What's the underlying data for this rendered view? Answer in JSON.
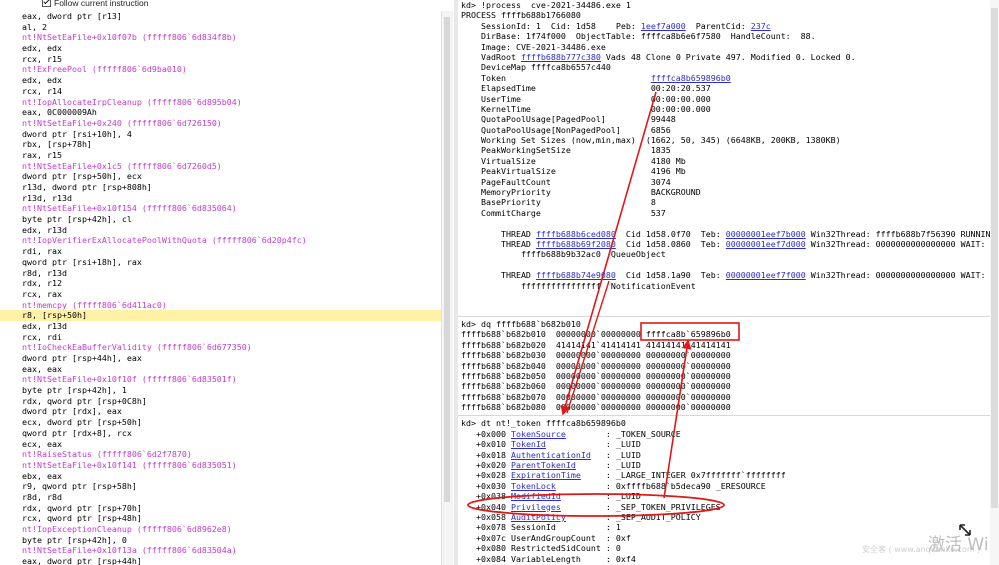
{
  "left_pane": {
    "follow_label": "Follow current instruction",
    "lines": [
      {
        "t": "eax, dword ptr [r13]",
        "c": false
      },
      {
        "t": "al, 2",
        "c": false
      },
      {
        "t": "nt!NtSetEaFile+0x10f07b (fffff806`6d834f8b)",
        "c": true
      },
      {
        "t": "edx, edx",
        "c": false
      },
      {
        "t": "rcx, r15",
        "c": false
      },
      {
        "t": "nt!ExFreePool (fffff806`6d9ba010)",
        "c": true
      },
      {
        "t": "edx, edx",
        "c": false
      },
      {
        "t": "rcx, r14",
        "c": false
      },
      {
        "t": "nt!IopAllocateIrpCleanup (fffff806`6d895b04)",
        "c": true
      },
      {
        "t": "eax, 0C000009Ah",
        "c": false
      },
      {
        "t": "nt!NtSetEaFile+0x240 (fffff806`6d726150)",
        "c": true
      },
      {
        "t": "dword ptr [rsi+10h], 4",
        "c": false
      },
      {
        "t": "rbx, [rsp+78h]",
        "c": false
      },
      {
        "t": "rax, r15",
        "c": false
      },
      {
        "t": "nt!NtSetEaFile+0x1c5 (fffff806`6d7260d5)",
        "c": true
      },
      {
        "t": "dword ptr [rsp+50h], ecx",
        "c": false
      },
      {
        "t": "r13d, dword ptr [rsp+808h]",
        "c": false
      },
      {
        "t": "r13d, r13d",
        "c": false
      },
      {
        "t": "nt!NtSetEaFile+0x10f154 (fffff806`6d835064)",
        "c": true
      },
      {
        "t": "byte ptr [rsp+42h], cl",
        "c": false
      },
      {
        "t": "edx, r13d",
        "c": false
      },
      {
        "t": "nt!IopVerifierExAllocatePoolWithQuota (fffff806`6d20p4fc)",
        "c": true
      },
      {
        "t": "rdi, rax",
        "c": false
      },
      {
        "t": "qword ptr [rsi+18h], rax",
        "c": false
      },
      {
        "t": "r8d, r13d",
        "c": false
      },
      {
        "t": "rdx, r12",
        "c": false
      },
      {
        "t": "rcx, rax",
        "c": false
      },
      {
        "t": "nt!memcpy (fffff806`6d411ac0)",
        "c": true
      },
      {
        "t": "r8, [rsp+50h]",
        "c": false,
        "hl": true
      },
      {
        "t": "edx, r13d",
        "c": false
      },
      {
        "t": "rcx, rdi",
        "c": false
      },
      {
        "t": "nt!IoCheckEaBufferValidity (fffff806`6d677350)",
        "c": true
      },
      {
        "t": "dword ptr [rsp+44h], eax",
        "c": false
      },
      {
        "t": "eax, eax",
        "c": false
      },
      {
        "t": "nt!NtSetEaFile+0x10f10f (fffff806`6d83501f)",
        "c": true
      },
      {
        "t": "byte ptr [rsp+42h], 1",
        "c": false
      },
      {
        "t": "rdx, qword ptr [rsp+0C8h]",
        "c": false
      },
      {
        "t": "dword ptr [rdx], eax",
        "c": false
      },
      {
        "t": "ecx, dword ptr [rsp+50h]",
        "c": false
      },
      {
        "t": "qword ptr [rdx+8], rcx",
        "c": false
      },
      {
        "t": "ecx, eax",
        "c": false
      },
      {
        "t": "nt!RaiseStatus (fffff806`6d2f7870)",
        "c": true
      },
      {
        "t": "nt!NtSetEaFile+0x10f141 (fffff806`6d835051)",
        "c": true
      },
      {
        "t": "ebx, eax",
        "c": false
      },
      {
        "t": "r9, qword ptr [rsp+58h]",
        "c": false
      },
      {
        "t": "r8d, r8d",
        "c": false
      },
      {
        "t": "rdx, qword ptr [rsp+70h]",
        "c": false
      },
      {
        "t": "rcx, qword ptr [rsp+48h]",
        "c": false
      },
      {
        "t": "nt!IopExceptionCleanup (fffff806`6d8962e8)",
        "c": true
      },
      {
        "t": "byte ptr [rsp+42h], 0",
        "c": false
      },
      {
        "t": "nt!NtSetEaFile+0x10f13a (fffff806`6d83504a)",
        "c": true
      },
      {
        "t": "eax, dword ptr [rsp+44h]",
        "c": false
      }
    ]
  },
  "right_pane": {
    "process": {
      "cmd": "kd> !process  cve-2021-34486.exe 1",
      "header": "PROCESS ffffb688b1766080",
      "l1a": "    SessionId: 1  Cid: 1d58    Peb: ",
      "peb": "1eef7a000",
      "l1b": "  ParentCid: ",
      "parentcid": "237c",
      "l2": "    DirBase: 1f74f000  ObjectTable: ffffca8b6e6f7580  HandleCount:  88.",
      "l3": "    Image: CVE-2021-34486.exe",
      "l4a": "    VadRoot ",
      "vadroot": "ffffb688b777c380",
      "l4b": " Vads 48 Clone 0 Private 497. Modified 0. Locked 0.",
      "l5": "    DeviceMap ffffca8b6557c440",
      "token_label": "    Token                             ",
      "token_val": "ffffca8b659896b0",
      "stats": [
        "    ElapsedTime                       00:20:20.537",
        "    UserTime                          00:00:00.000",
        "    KernelTime                        00:00:00.000",
        "    QuotaPoolUsage[PagedPool]         99448",
        "    QuotaPoolUsage[NonPagedPool]      6856",
        "    Working Set Sizes (now,min,max)  (1662, 50, 345) (6648KB, 200KB, 1380KB)",
        "    PeakWorkingSetSize                1835",
        "    VirtualSize                       4180 Mb",
        "    PeakVirtualSize                   4196 Mb",
        "    PageFaultCount                    3074",
        "    MemoryPriority                    BACKGROUND",
        "    BasePriority                      8",
        "    CommitCharge                      537"
      ],
      "thread1": {
        "pre": "        THREAD ",
        "addr": "ffffb688b6ced080",
        "mid": "  Cid 1d58.0f70  Teb: ",
        "teb": "00000001eef7b000",
        "post": " Win32Thread: ffffb688b7f56390 RUNNING on processor 0"
      },
      "thread2": {
        "pre": "        THREAD ",
        "addr": "ffffb688b69f2080",
        "mid": "  Cid 1d58.0860  Teb: ",
        "teb": "00000001eef7d000",
        "post": " Win32Thread: 0000000000000000 WAIT: (WrQueue) UserMode Alertable"
      },
      "thread2b": "            ffffb688b9b32ac0  QueueObject",
      "thread3": {
        "pre": "        THREAD ",
        "addr": "ffffb688b74e9080",
        "mid": "  Cid 1d58.1a90  Teb: ",
        "teb": "00000001eef7f000",
        "post": " Win32Thread: 0000000000000000 WAIT: (DelayExecution) UserMode"
      },
      "thread3b": "            ffffffffffffffff  NotificationEvent"
    },
    "dq": {
      "cmd": "kd> dq ffffb688`b682b010",
      "rows": [
        "ffffb688`b682b010  00000000`00000000 ffffca8b`659896b0",
        "ffffb688`b682b020  41414141`41414141 41414141`41414141",
        "ffffb688`b682b030  00000000`00000000 00000000`00000000",
        "ffffb688`b682b040  00000000`00000000 00000000`00000000",
        "ffffb688`b682b050  00000000`00000000 00000000`00000000",
        "ffffb688`b682b060  00000000`00000000 00000000`00000000",
        "ffffb688`b682b070  00000000`00000000 00000000`00000000",
        "ffffb688`b682b080  00000000`00000000 00000000`00000000"
      ]
    },
    "dt": {
      "cmd": "kd> dt nt!_token ffffca8b659896b0",
      "fields": [
        {
          "off": "   +0x000 ",
          "name": "TokenSource",
          "type": "        : _TOKEN_SOURCE",
          "link": true
        },
        {
          "off": "   +0x010 ",
          "name": "TokenId",
          "type": "            : _LUID",
          "link": true
        },
        {
          "off": "   +0x018 ",
          "name": "AuthenticationId",
          "type": "   : _LUID",
          "link": true
        },
        {
          "off": "   +0x020 ",
          "name": "ParentTokenId",
          "type": "      : _LUID",
          "link": true
        },
        {
          "off": "   +0x028 ",
          "name": "ExpirationTime",
          "type": "     : _LARGE_INTEGER 0x7fffffff`ffffffff",
          "link": true
        },
        {
          "off": "   +0x030 ",
          "name": "TokenLock",
          "type": "          : 0xffffb688`b5deca90 _ERESOURCE",
          "link": true
        },
        {
          "off": "   +0x038 ",
          "name": "ModifiedId",
          "type": "         : _LUID",
          "link": true
        },
        {
          "off": "   +0x040 ",
          "name": "Privileges",
          "type": "         : _SEP_TOKEN_PRIVILEGES",
          "link": true
        },
        {
          "off": "   +0x058 ",
          "name": "AuditPolicy",
          "type": "        : _SEP_AUDIT_POLICY",
          "link": true
        },
        {
          "off": "   +0x078 ",
          "name": "SessionId",
          "type": "          : 1",
          "link": false
        },
        {
          "off": "   +0x07c ",
          "name": "UserAndGroupCount",
          "type": "  : 0xf",
          "link": false
        },
        {
          "off": "   +0x080 ",
          "name": "RestrictedSidCount",
          "type": " : 0",
          "link": false
        },
        {
          "off": "   +0x084 ",
          "name": "VariableLength",
          "type": "     : 0xf4",
          "link": false
        }
      ]
    }
  },
  "watermark": {
    "main": "激活 Wi",
    "sub": "安全客 ( www.anquanke.com )"
  },
  "colors": {
    "disasm_call": "#c03ccc",
    "link": "#2b2bd0",
    "highlight": "#fff2a6",
    "annotation_red": "#e01818"
  }
}
